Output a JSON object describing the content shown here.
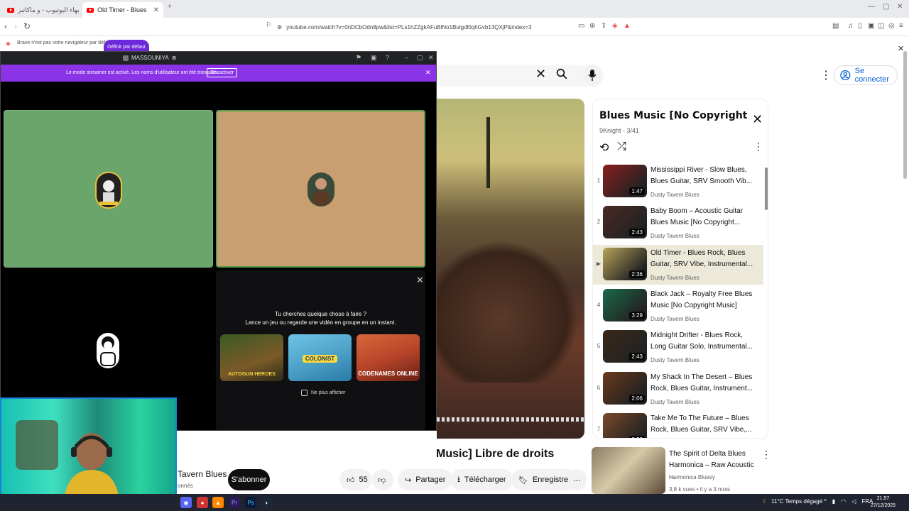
{
  "browser": {
    "tabs": [
      {
        "label": "فورت سكاتنز بهاء اليوتيوب - و ماكاتبز"
      },
      {
        "label": "Old Timer - Blues Rock, Blues"
      }
    ],
    "url": "youtube.com/watch?v=0nDCbOdn8pw&list=PLs1hZZgkAFuBlNo1Bulgdl0qhGvb13QXjP&index=3",
    "infobar_text": "Brave n'est pas votre navigateur par défaut",
    "infobar_button": "Définir par défaut"
  },
  "youtube": {
    "signin": "Se connecter",
    "playlist": {
      "title": "Blues Music [No Copyright Music] Bl...",
      "subtitle": "9Knight - 3/41",
      "items": [
        {
          "index": "1",
          "title": "Mississippi River - Slow Blues, Blues Guitar, SRV Smooth Vib...",
          "channel": "Dusty Tavern Blues",
          "duration": "1:47",
          "color": "#8a1f1f"
        },
        {
          "index": "2",
          "title": "Baby Boom – Acoustic Guitar Blues Music [No Copyright...",
          "channel": "Dusty Tavern Blues",
          "duration": "2:43",
          "color": "#4a2a25"
        },
        {
          "index": "▶",
          "title": "Old Timer - Blues Rock, Blues Guitar, SRV Vibe, Instrumental...",
          "channel": "Dusty Tavern Blues",
          "duration": "2:36",
          "color": "#b8a45a"
        },
        {
          "index": "4",
          "title": "Black Jack – Royalty Free Blues Music [No Copyright Music]",
          "channel": "Dusty Tavern Blues",
          "duration": "3:29",
          "color": "#1a6a4a"
        },
        {
          "index": "5",
          "title": "Midnight Drifter - Blues Rock, Long Guitar Solo, Instrumental...",
          "channel": "Dusty Tavern Blues",
          "duration": "2:43",
          "color": "#3a2818"
        },
        {
          "index": "6",
          "title": "My Shack In The Desert – Blues Rock, Blues Guitar, Instrument...",
          "channel": "Dusty Tavern Blues",
          "duration": "2:06",
          "color": "#6a3a1a"
        },
        {
          "index": "7",
          "title": "Take Me To The Future – Blues Rock, Blues Guitar, SRV Vibe,...",
          "channel": "Dusty Tavern Blues",
          "duration": "2:33",
          "color": "#7a4a2a"
        }
      ]
    },
    "video_title_fragment": "Music] Libre de droits",
    "channel_fragment": "Tavern Blues",
    "subs_fragment": "onnés",
    "subscribe": "S'abonner",
    "likes": "55",
    "share": "Partager",
    "download": "Télécharger",
    "save": "Enregistrer",
    "recommended": {
      "title": "The Spirit of Delta Blues Harmonica – Raw Acoustic ...",
      "channel": "Harmonica Bluesy",
      "meta": "3,8 k vues • il y a 3 mois"
    }
  },
  "discord": {
    "window_title": "MASSOUNIYA",
    "streamer_msg": "Le mode streamer est activé. Les noms d'utilisateur ont été tronqués.",
    "streamer_btn": "Désactiver",
    "activity_q1": "Tu cherches quelque chose à faire ?",
    "activity_q2": "Lance un jeu ou regarde une vidéo en groupe en un instant.",
    "games": [
      {
        "name": "AUTOGUN HEROES",
        "color": "#5b4a2a"
      },
      {
        "name": "COLONIST",
        "color": "#4fa3c8"
      },
      {
        "name": "CODENAMES ONLINE",
        "color": "#b8452a"
      }
    ],
    "no_show": "Ne plus afficher"
  },
  "taskbar": {
    "weather": "11°C  Temps dégagé",
    "lang": "FRA",
    "time": "21:57",
    "date": "27/12/2025"
  }
}
